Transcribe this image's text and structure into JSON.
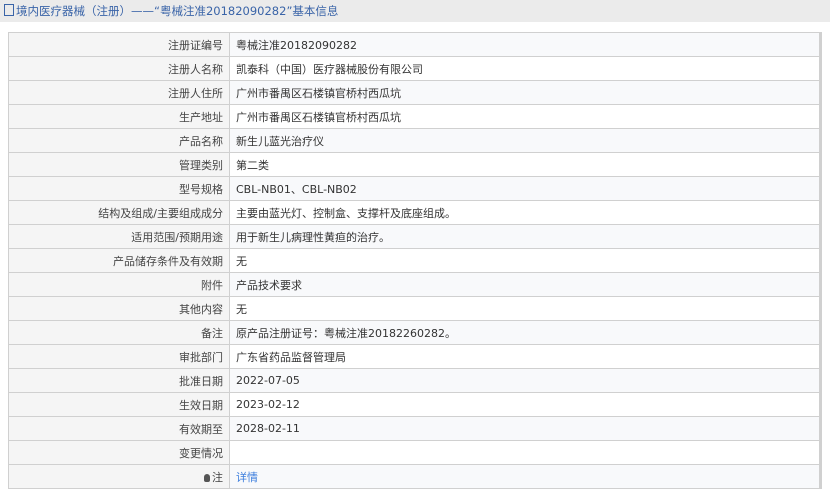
{
  "title": "境内医疗器械（注册）——“粤械注准20182090282”基本信息",
  "rows": [
    {
      "label": "注册证编号",
      "value": "粤械注准20182090282"
    },
    {
      "label": "注册人名称",
      "value": "凯泰科（中国）医疗器械股份有限公司"
    },
    {
      "label": "注册人住所",
      "value": "广州市番禺区石楼镇官桥村西瓜坑"
    },
    {
      "label": "生产地址",
      "value": "广州市番禺区石楼镇官桥村西瓜坑"
    },
    {
      "label": "产品名称",
      "value": "新生儿蓝光治疗仪"
    },
    {
      "label": "管理类别",
      "value": "第二类"
    },
    {
      "label": "型号规格",
      "value": "CBL-NB01、CBL-NB02"
    },
    {
      "label": "结构及组成/主要组成成分",
      "value": "主要由蓝光灯、控制盒、支撑杆及底座组成。"
    },
    {
      "label": "适用范围/预期用途",
      "value": "用于新生儿病理性黄疸的治疗。"
    },
    {
      "label": "产品储存条件及有效期",
      "value": "无"
    },
    {
      "label": "附件",
      "value": "产品技术要求"
    },
    {
      "label": "其他内容",
      "value": "无"
    },
    {
      "label": "备注",
      "value": "原产品注册证号：粤械注准20182260282。"
    },
    {
      "label": "审批部门",
      "value": "广东省药品监督管理局"
    },
    {
      "label": "批准日期",
      "value": "2022-07-05"
    },
    {
      "label": "生效日期",
      "value": "2023-02-12"
    },
    {
      "label": "有效期至",
      "value": "2028-02-11"
    },
    {
      "label": "变更情况",
      "value": ""
    }
  ],
  "note": {
    "label": "注",
    "link": "详情"
  }
}
